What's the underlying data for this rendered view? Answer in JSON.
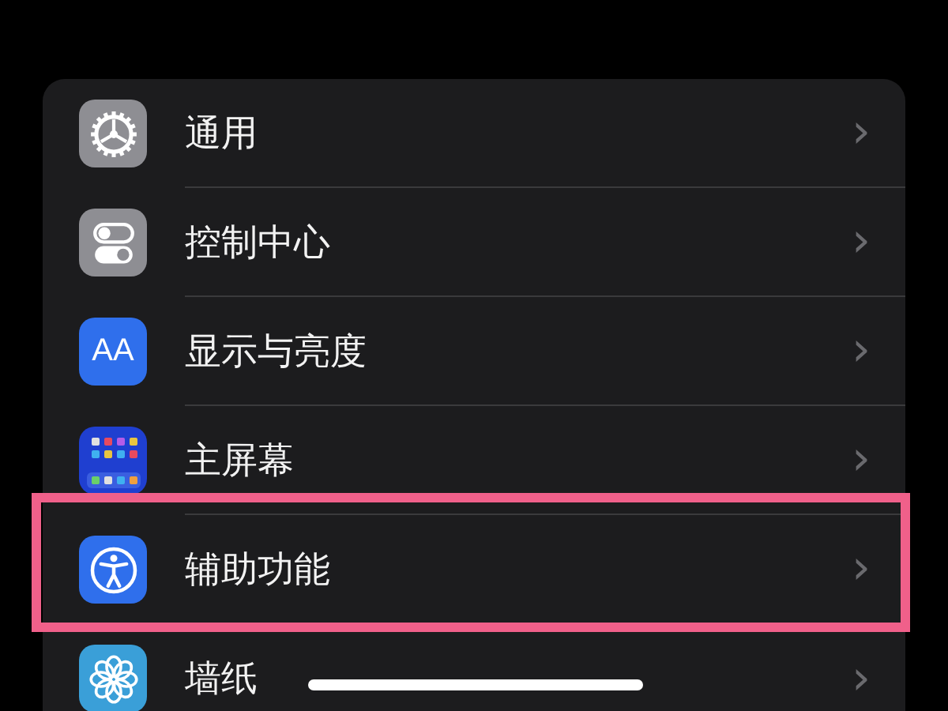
{
  "settings": [
    {
      "label": "通用",
      "kind": "gear",
      "highlighted": false
    },
    {
      "label": "控制中心",
      "kind": "toggles",
      "highlighted": false
    },
    {
      "label": "显示与亮度",
      "kind": "display",
      "icon_text": "AA",
      "highlighted": false
    },
    {
      "label": "主屏幕",
      "kind": "grid",
      "highlighted": false
    },
    {
      "label": "辅助功能",
      "kind": "accessibility",
      "highlighted": true
    },
    {
      "label": "墙纸",
      "kind": "flower",
      "highlighted": false
    }
  ],
  "chevron": "›"
}
